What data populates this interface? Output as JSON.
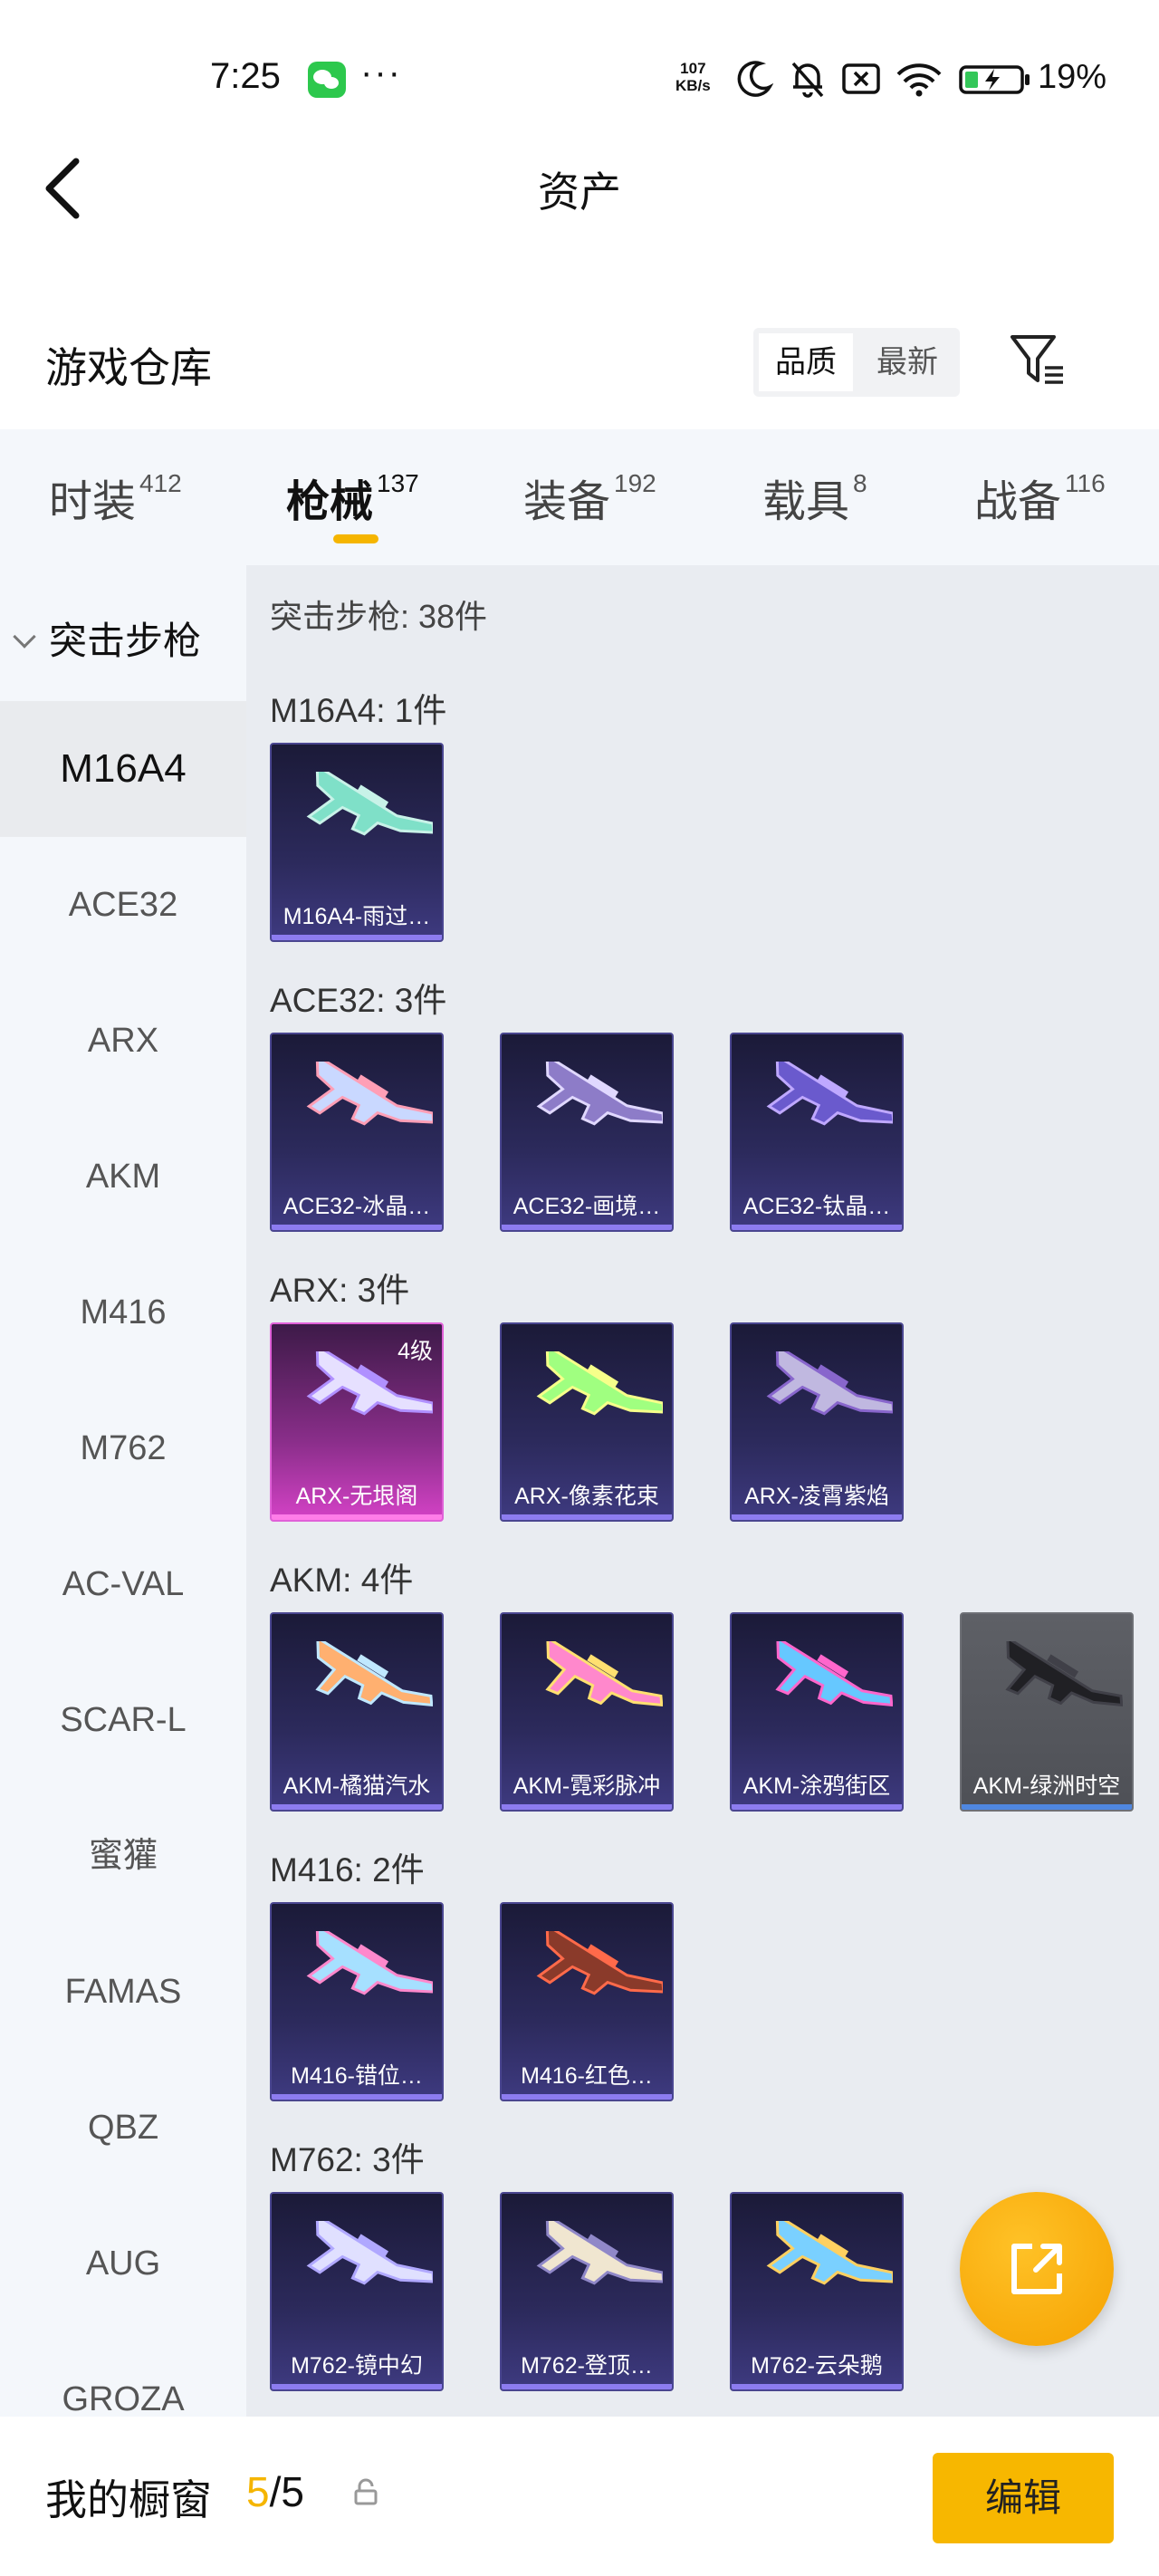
{
  "status_bar": {
    "time": "7:25",
    "more": "···",
    "net_speed_value": "107",
    "net_speed_unit": "KB/s",
    "battery": "19%"
  },
  "header": {
    "title": "资产"
  },
  "warehouse": {
    "title": "游戏仓库",
    "sort_options": [
      "品质",
      "最新"
    ],
    "sort_selected": "品质"
  },
  "tabs": [
    {
      "label": "时装",
      "count": "412"
    },
    {
      "label": "枪械",
      "count": "137"
    },
    {
      "label": "装备",
      "count": "192"
    },
    {
      "label": "载具",
      "count": "8"
    },
    {
      "label": "战备",
      "count": "116"
    }
  ],
  "sidebar": {
    "group": "突击步枪",
    "items": [
      "M16A4",
      "ACE32",
      "ARX",
      "AKM",
      "M416",
      "M762",
      "AC-VAL",
      "SCAR-L",
      "蜜獾",
      "FAMAS",
      "QBZ",
      "AUG",
      "GROZA"
    ],
    "selected": "M16A4"
  },
  "content": {
    "group_total": "突击步枪: 38件",
    "sections": [
      {
        "header": "M16A4: 1件",
        "items": [
          {
            "name": "M16A4-雨过…",
            "rarity": "purple"
          }
        ]
      },
      {
        "header": "ACE32: 3件",
        "items": [
          {
            "name": "ACE32-冰晶…",
            "rarity": "purple"
          },
          {
            "name": "ACE32-画境…",
            "rarity": "purple"
          },
          {
            "name": "ACE32-钛晶…",
            "rarity": "purple"
          }
        ]
      },
      {
        "header": "ARX: 3件",
        "items": [
          {
            "name": "ARX-无垠阁",
            "rarity": "pink",
            "level": "4级"
          },
          {
            "name": "ARX-像素花束",
            "rarity": "purple"
          },
          {
            "name": "ARX-凌霄紫焰",
            "rarity": "purple"
          }
        ]
      },
      {
        "header": "AKM: 4件",
        "items": [
          {
            "name": "AKM-橘猫汽水",
            "rarity": "purple"
          },
          {
            "name": "AKM-霓彩脉冲",
            "rarity": "purple"
          },
          {
            "name": "AKM-涂鸦街区",
            "rarity": "purple"
          },
          {
            "name": "AKM-绿洲时空",
            "rarity": "grey"
          }
        ]
      },
      {
        "header": "M416: 2件",
        "items": [
          {
            "name": "M416-错位…",
            "rarity": "purple"
          },
          {
            "name": "M416-红色…",
            "rarity": "purple"
          }
        ]
      },
      {
        "header": "M762: 3件",
        "items": [
          {
            "name": "M762-镜中幻",
            "rarity": "purple"
          },
          {
            "name": "M762-登顶…",
            "rarity": "purple"
          },
          {
            "name": "M762-云朵鹅",
            "rarity": "purple"
          }
        ]
      }
    ]
  },
  "bottom_bar": {
    "title": "我的橱窗",
    "showcase_used": "5",
    "showcase_total": "/5",
    "edit_label": "编辑"
  },
  "colors": {
    "accent": "#f5b500",
    "card_purple": "#2c2a5c",
    "card_pink": "#d442c6",
    "card_grey": "#5e6066"
  }
}
